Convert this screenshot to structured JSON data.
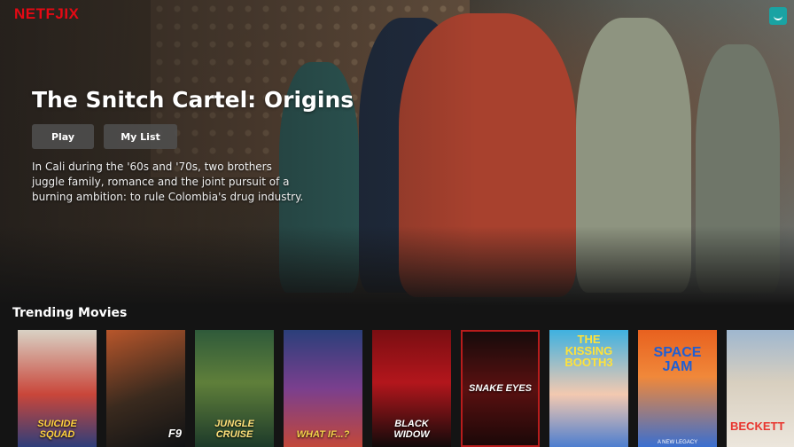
{
  "app": {
    "logo_text": "NETFJIX",
    "brand_color": "#e50914",
    "avatar_icon": "smile-icon",
    "avatar_color": "#1aa3a3"
  },
  "hero": {
    "title": "The Snitch Cartel: Origins",
    "play_label": "Play",
    "mylist_label": "My List",
    "description": "In Cali during the '60s and '70s, two brothers juggle family, romance and the joint pursuit of a burning ambition: to rule Colombia's drug industry."
  },
  "trending": {
    "title": "Trending Movies",
    "posters": [
      {
        "name": "poster-suicide-squad",
        "top": "",
        "label": "SUICIDE SQUAD",
        "sub": ""
      },
      {
        "name": "poster-f9",
        "top": "",
        "label": "F9",
        "sub": ""
      },
      {
        "name": "poster-jungle-cruise",
        "top": "",
        "label": "JUNGLE CRUISE",
        "sub": ""
      },
      {
        "name": "poster-what-if",
        "top": "",
        "label": "WHAT IF...?",
        "sub": ""
      },
      {
        "name": "poster-black-widow",
        "top": "",
        "label": "BLACK WIDOW",
        "sub": ""
      },
      {
        "name": "poster-snake-eyes",
        "top": "",
        "label": "SNAKE EYES",
        "sub": ""
      },
      {
        "name": "poster-kissing-booth-3",
        "top": "THE KISSING BOOTH3",
        "label": "",
        "sub": ""
      },
      {
        "name": "poster-space-jam",
        "top": "SPACE JAM",
        "label": "",
        "sub": "A NEW LEGACY"
      },
      {
        "name": "poster-beckett",
        "top": "",
        "label": "BECKETT",
        "sub": ""
      }
    ]
  }
}
